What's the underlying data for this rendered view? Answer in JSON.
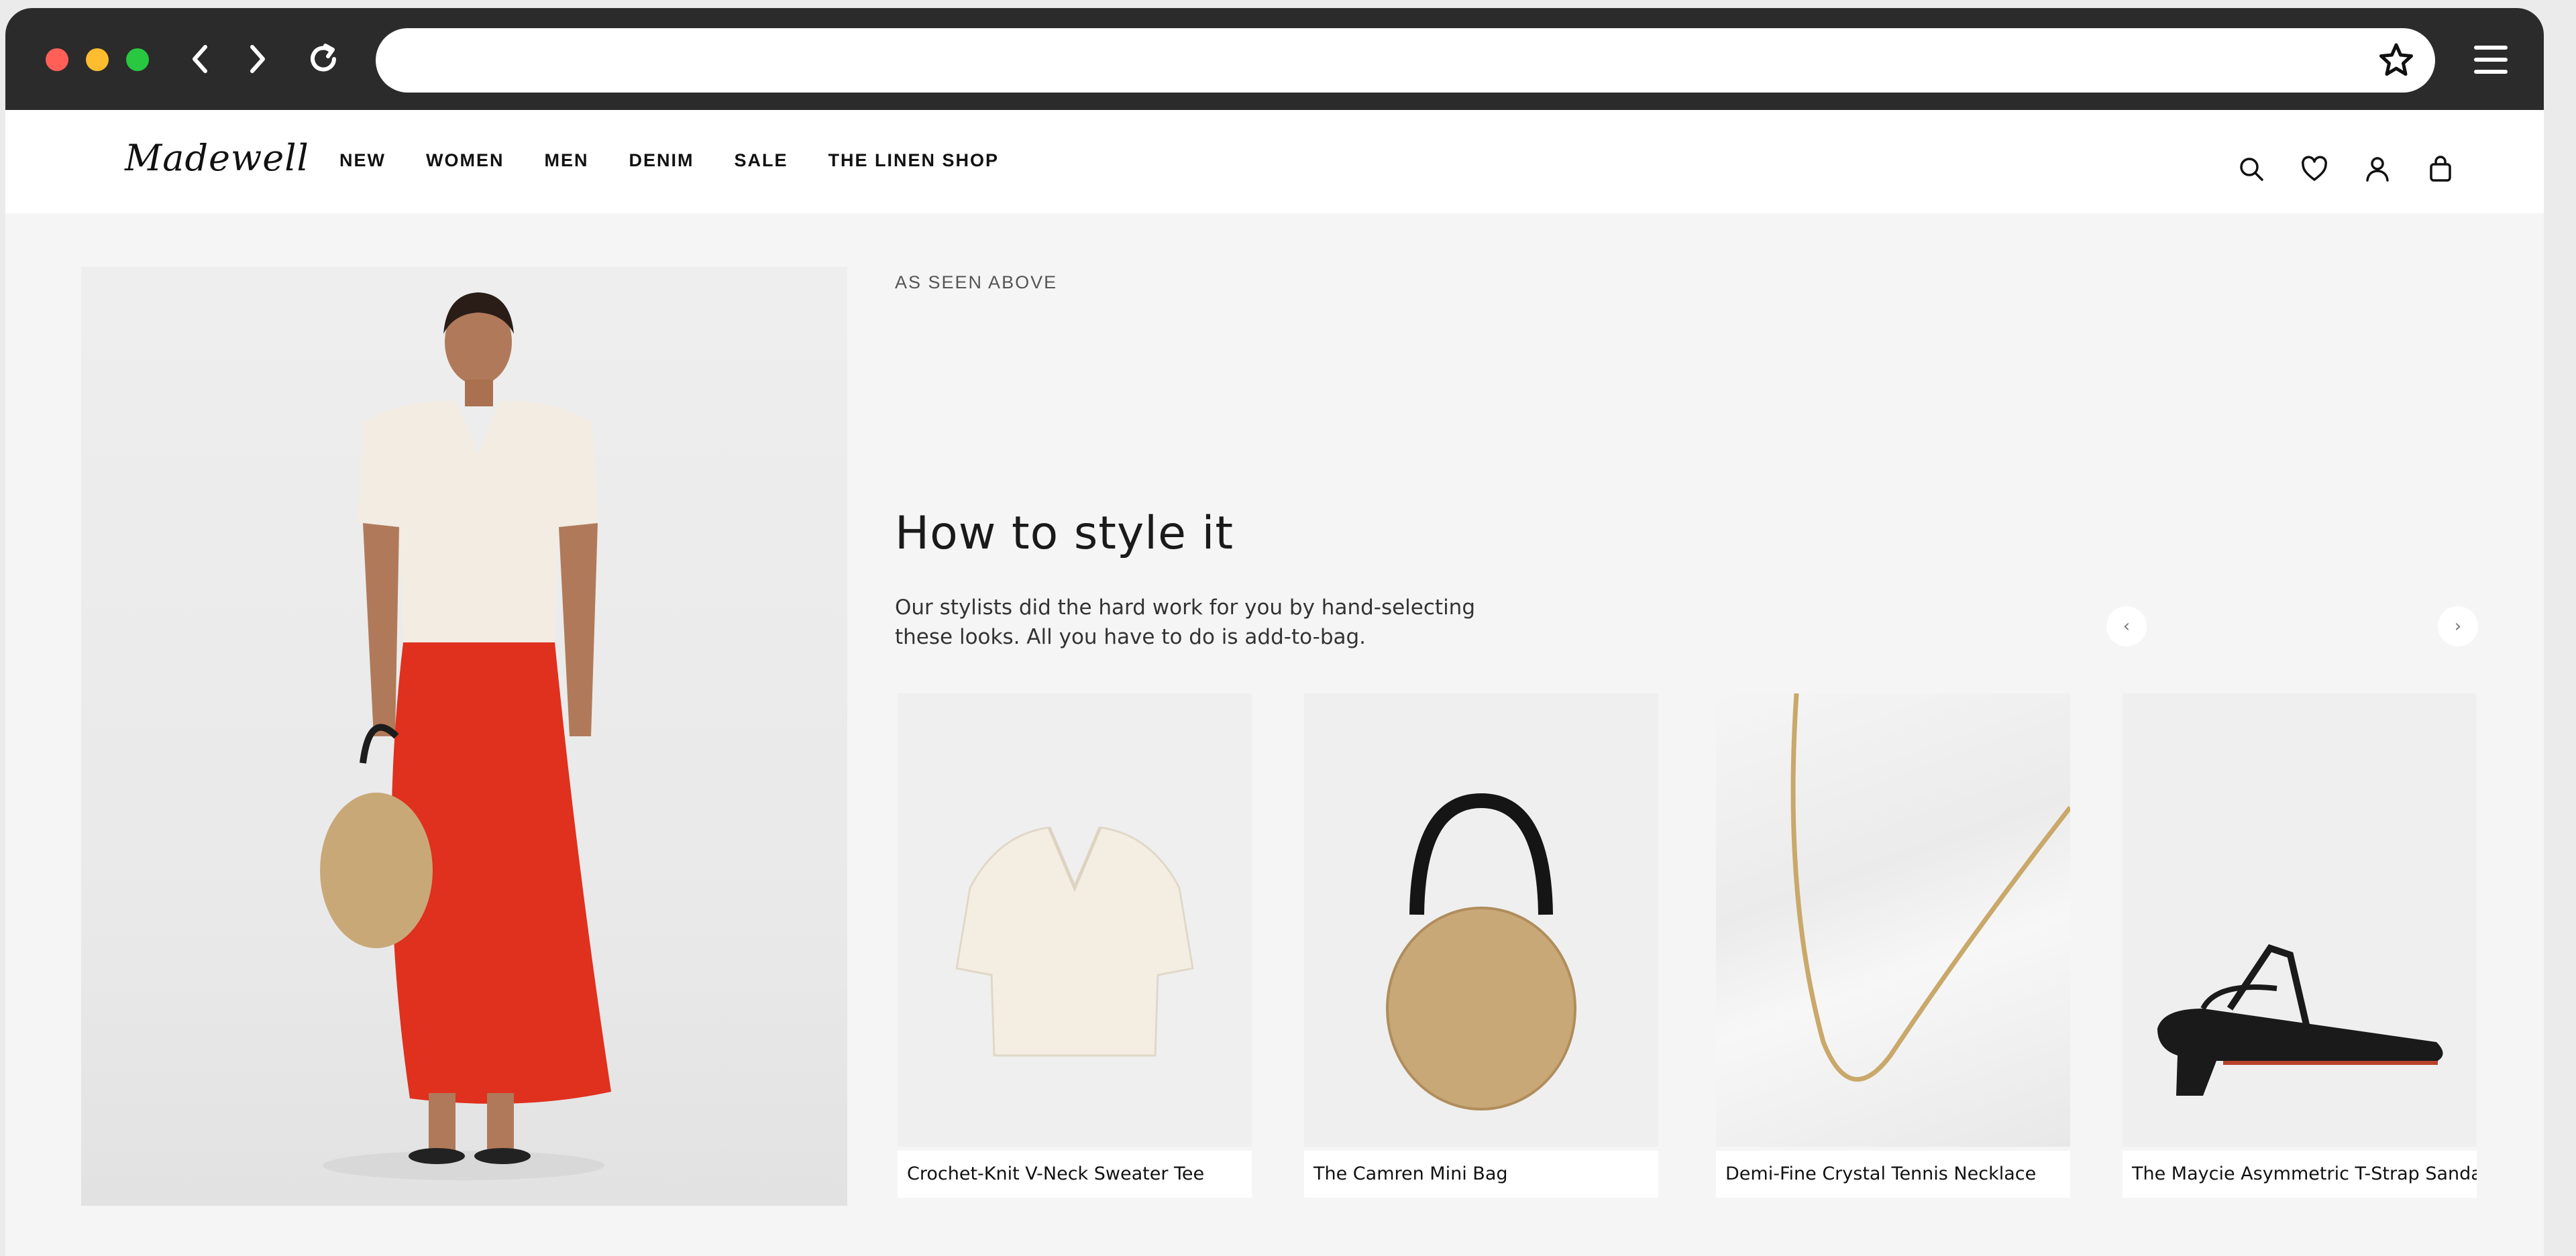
{
  "brand": {
    "logo": "Madewell"
  },
  "nav": {
    "items": [
      "NEW",
      "WOMEN",
      "MEN",
      "DENIM",
      "SALE",
      "THE LINEN SHOP"
    ]
  },
  "section": {
    "eyebrow": "AS SEEN ABOVE",
    "title": "How to style it",
    "description": "Our stylists did the hard work for you by hand-selecting these looks. All you have to do is add-to-bag."
  },
  "carousel": {
    "prev_icon": "‹",
    "next_icon": "›"
  },
  "products": [
    {
      "name": "Crochet-Knit V-Neck Sweater Tee"
    },
    {
      "name": "The Camren Mini Bag"
    },
    {
      "name": "Demi-Fine Crystal Tennis Necklace"
    },
    {
      "name": "The Maycie Asymmetric T-Strap Sandal"
    }
  ],
  "icons": {
    "chrome": [
      "back-icon",
      "forward-icon",
      "reload-icon",
      "star-icon",
      "menu-icon"
    ],
    "header": [
      "search-icon",
      "heart-icon",
      "account-icon",
      "bag-icon"
    ]
  },
  "colors": {
    "skirt": "#e0301e",
    "page_bg": "#f5f5f5",
    "chrome_bg": "#2b2b2b"
  }
}
